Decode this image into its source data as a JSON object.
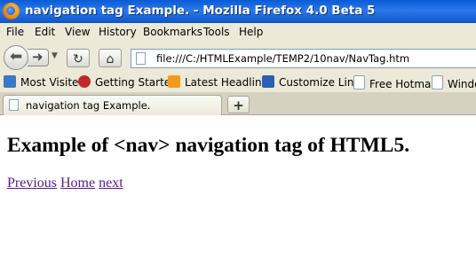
{
  "window": {
    "title": "navigation tag Example. - Mozilla Firefox 4.0 Beta 5"
  },
  "menu": [
    "File",
    "Edit",
    "View",
    "History",
    "Bookmarks",
    "Tools",
    "Help"
  ],
  "navbar": {
    "url": "file:///C:/HTMLExample/TEMP2/10nav/NavTag.htm",
    "icons": [
      "back-arrow-icon",
      "forward-arrow-icon",
      "dropdown-icon",
      "reload-icon",
      "home-icon",
      "page-icon"
    ]
  },
  "bookmarks": [
    {
      "label": "Most Visited",
      "icon": "most-visited-icon",
      "color": "#3a78c8"
    },
    {
      "label": "Getting Started",
      "icon": "firefox-icon",
      "color": "#c0282a"
    },
    {
      "label": "Latest Headlines",
      "icon": "rss-icon",
      "color": "#f39a1c"
    },
    {
      "label": "Customize Links",
      "icon": "msn-icon",
      "color": "#2a5fb8"
    },
    {
      "label": "Free Hotmail",
      "icon": "page-icon",
      "color": "#ffffff"
    },
    {
      "label": "Windows",
      "icon": "page-icon",
      "color": "#ffffff"
    }
  ],
  "tabs": {
    "active_label": "navigation tag Example.",
    "new_tab_symbol": "+"
  },
  "page": {
    "heading": "Example of <nav> navigation tag of HTML5.",
    "links": [
      "Previous",
      "Home",
      "next"
    ],
    "link_color": "#551a8b"
  }
}
